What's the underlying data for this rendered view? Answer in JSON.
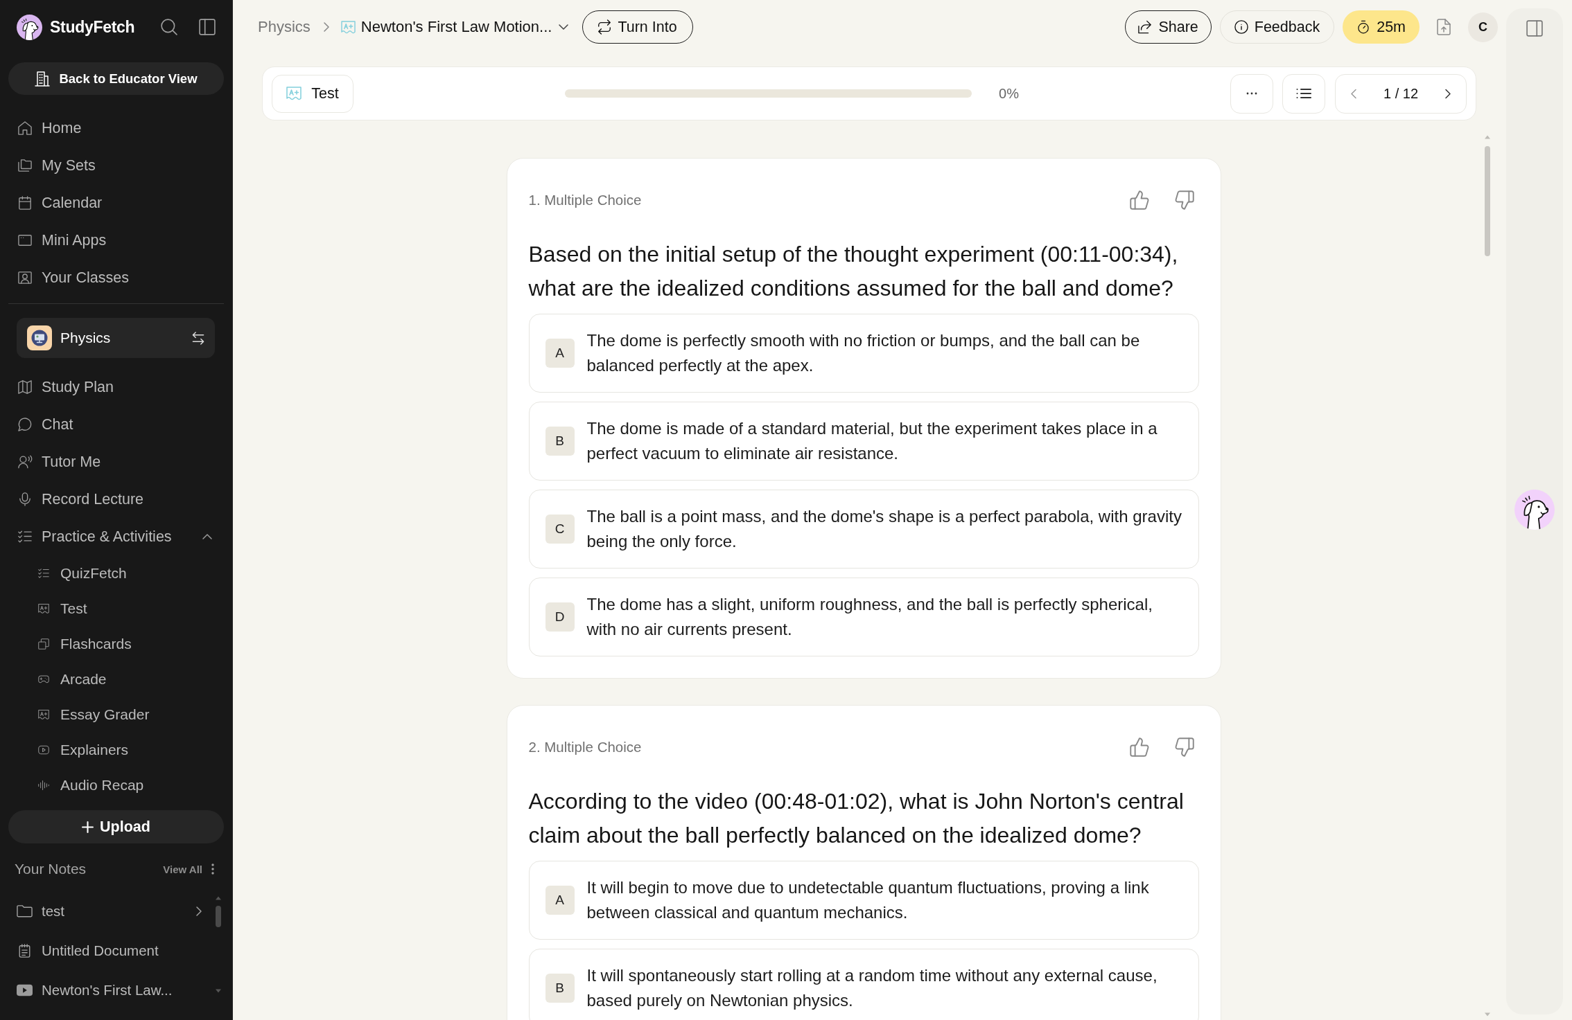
{
  "sidebar": {
    "brand": "StudyFetch",
    "educator_button": "Back to Educator View",
    "nav": [
      {
        "label": "Home"
      },
      {
        "label": "My Sets"
      },
      {
        "label": "Calendar"
      },
      {
        "label": "Mini Apps"
      },
      {
        "label": "Your Classes"
      }
    ],
    "class_switcher": "Physics",
    "class_nav": [
      {
        "label": "Study Plan"
      },
      {
        "label": "Chat"
      },
      {
        "label": "Tutor Me"
      },
      {
        "label": "Record Lecture"
      }
    ],
    "practice": {
      "label": "Practice & Activities",
      "expanded": true,
      "children": [
        {
          "label": "QuizFetch"
        },
        {
          "label": "Test"
        },
        {
          "label": "Flashcards"
        },
        {
          "label": "Arcade"
        },
        {
          "label": "Essay Grader"
        },
        {
          "label": "Explainers"
        },
        {
          "label": "Audio Recap"
        }
      ]
    },
    "upload_button": "Upload",
    "notes": {
      "title": "Your Notes",
      "view_all": "View All",
      "items": [
        {
          "kind": "folder",
          "label": "test"
        },
        {
          "kind": "document",
          "label": "Untitled Document"
        },
        {
          "kind": "video",
          "label": "Newton's First Law..."
        }
      ]
    }
  },
  "topbar": {
    "breadcrumb": {
      "parent": "Physics",
      "current": "Newton's First Law Motion..."
    },
    "turn_into_button": "Turn Into",
    "share_button": "Share",
    "feedback_button": "Feedback",
    "timer": "25m",
    "avatar": "C"
  },
  "toolbar": {
    "mode_button": "Test",
    "progress": {
      "level": 0,
      "reading": "0%"
    },
    "pager": "1 / 12"
  },
  "questions": [
    {
      "label": "1. Multiple Choice",
      "text": "Based on the initial setup of the thought experiment (00:11-00:34), what are the idealized conditions assumed for the ball and dome?",
      "options": [
        {
          "letter": "A",
          "text": "The dome is perfectly smooth with no friction or bumps, and the ball can be balanced perfectly at the apex.",
          "selected": false
        },
        {
          "letter": "B",
          "text": "The dome is made of a standard material, but the experiment takes place in a perfect vacuum to eliminate air resistance.",
          "selected": false
        },
        {
          "letter": "C",
          "text": "The ball is a point mass, and the dome's shape is a perfect parabola, with gravity being the only force.",
          "selected": false
        },
        {
          "letter": "D",
          "text": "The dome has a slight, uniform roughness, and the ball is perfectly spherical, with no air currents present.",
          "selected": false
        }
      ]
    },
    {
      "label": "2. Multiple Choice",
      "text": "According to the video (00:48-01:02), what is John Norton's central claim about the ball perfectly balanced on the idealized dome?",
      "options": [
        {
          "letter": "A",
          "text": "It will begin to move due to undetectable quantum fluctuations, proving a link between classical and quantum mechanics.",
          "selected": false
        },
        {
          "letter": "B",
          "text": "It will spontaneously start rolling at a random time without any external cause, based purely on Newtonian physics.",
          "selected": false
        }
      ]
    }
  ]
}
